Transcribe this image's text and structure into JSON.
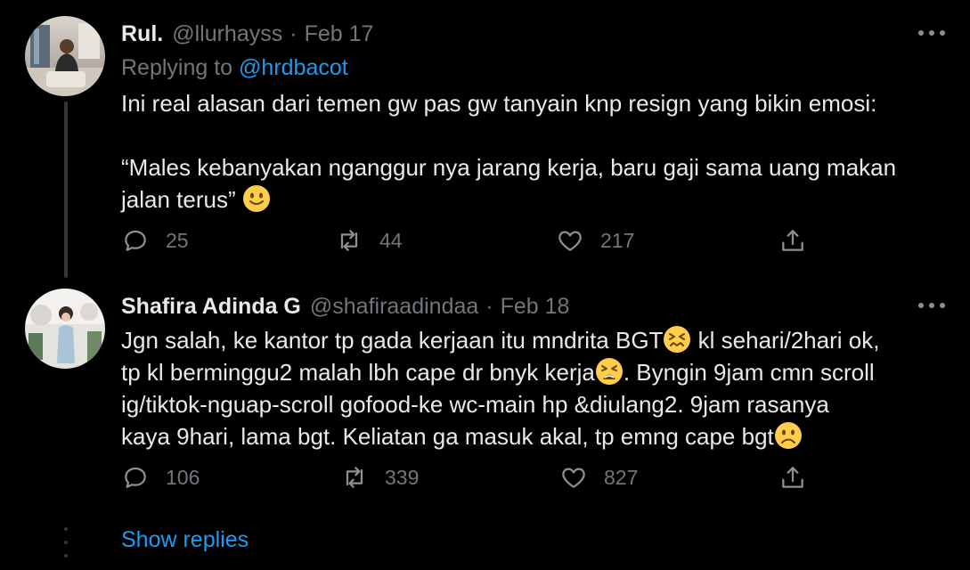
{
  "tweets": [
    {
      "name": "Rul.",
      "handle": "@llurhayss",
      "separator": "·",
      "date": "Feb 17",
      "replying_label": "Replying to",
      "replying_to": "@hrdbacot",
      "text_lines": [
        "Ini real alasan dari temen gw pas gw tanyain knp resign yang bikin emosi:",
        "“Males kebanyakan nganggur nya jarang kerja, baru gaji sama uang makan",
        "jalan terus”"
      ],
      "emoji": [
        "slightly-smiling-face"
      ],
      "replies": "25",
      "retweets": "44",
      "likes": "217"
    },
    {
      "name": "Shafira Adinda G",
      "handle": "@shafiraadindaa",
      "separator": "·",
      "date": "Feb 18",
      "text_segments": [
        "Jgn salah, ke kantor tp gada kerjaan itu mndrita BGT",
        " kl sehari/2hari ok,",
        "tp kl berminggu2 malah lbh cape dr bnyk kerja",
        ". Byngin 9jam cmn scroll",
        "ig/tiktok-nguap-scroll gofood-ke wc-main hp &diulang2. 9jam rasanya",
        "kaya 9hari, lama bgt.  Keliatan ga masuk akal, tp emng cape bgt"
      ],
      "emoji": [
        "confounded-face",
        "tired-face",
        "frowning-face"
      ],
      "replies": "106",
      "retweets": "339",
      "likes": "827"
    }
  ],
  "show_replies": "Show replies",
  "colors": {
    "background": "#000000",
    "text": "#e7e9ea",
    "muted": "#71767b",
    "link": "#1d9bf0",
    "thread_line": "#333639",
    "emoji_yellow": "#ffcc4d"
  }
}
